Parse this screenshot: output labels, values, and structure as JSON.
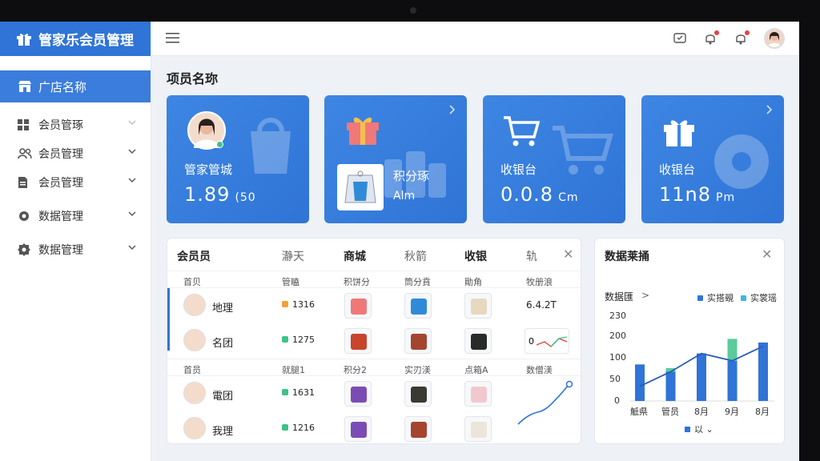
{
  "app": {
    "title": "管家乐会员管理"
  },
  "sidebar": {
    "active": "广店名称",
    "items": [
      {
        "label": "会员管琢",
        "icon": "grid-icon"
      },
      {
        "label": "会员管理",
        "icon": "users-icon"
      },
      {
        "label": "会员管理",
        "icon": "document-icon"
      },
      {
        "label": "数据管理",
        "icon": "settings-icon"
      },
      {
        "label": "数据管理",
        "icon": "gear-icon"
      }
    ]
  },
  "page": {
    "title": "项员名珎"
  },
  "cards": [
    {
      "label": "管家管城",
      "value": "1.89",
      "unit": "(50"
    },
    {
      "label": "积分琢",
      "value": "",
      "unit": "Alm"
    },
    {
      "label": "收银台",
      "value": "0.0.8",
      "unit": "Cm"
    },
    {
      "label": "收银台",
      "value": "11n8",
      "unit": "Pm"
    }
  ],
  "members_panel": {
    "tabs": [
      "会员员",
      "瀞天",
      "商城",
      "秋箭",
      "收银",
      "轨"
    ],
    "header1": [
      "首贝",
      "管瞌",
      "积饼分",
      "筒分賁",
      "勛角",
      "牧册浪"
    ],
    "header2": [
      "首员",
      "就腿1",
      "积分2",
      "实刃渼",
      "点箱A",
      "数僧渼"
    ],
    "rows": [
      {
        "name": "地理",
        "points": "1316",
        "extra": "6.4.2T"
      },
      {
        "name": "名团",
        "points": "1275",
        "extra": "0"
      },
      {
        "name": "電团",
        "points": "1631",
        "extra": ""
      },
      {
        "name": "我理",
        "points": "1216",
        "extra": ""
      }
    ]
  },
  "data_panel": {
    "title": "数据莱捅",
    "subtitle": "数据匯",
    "subtitle_arrow": ">",
    "legend": [
      "实搭覡",
      "实裳瑶"
    ],
    "footer": "以",
    "colors": {
      "series1": "#2f74d6",
      "series2": "#3dc28a",
      "line": "#2a5bb8"
    }
  },
  "chart_data": {
    "type": "bar",
    "categories": [
      "觝県",
      "管员",
      "8月",
      "9月",
      "8月"
    ],
    "series": [
      {
        "name": "实搭覡",
        "values": [
          100,
          80,
          130,
          110,
          160
        ]
      },
      {
        "name": "实裳瑶",
        "values": [
          0,
          90,
          0,
          170,
          0
        ]
      }
    ],
    "line": [
      40,
      80,
      130,
      110,
      150
    ],
    "yticks": [
      "230",
      "200",
      "100",
      "50",
      "0"
    ],
    "ylim": [
      0,
      230
    ]
  }
}
